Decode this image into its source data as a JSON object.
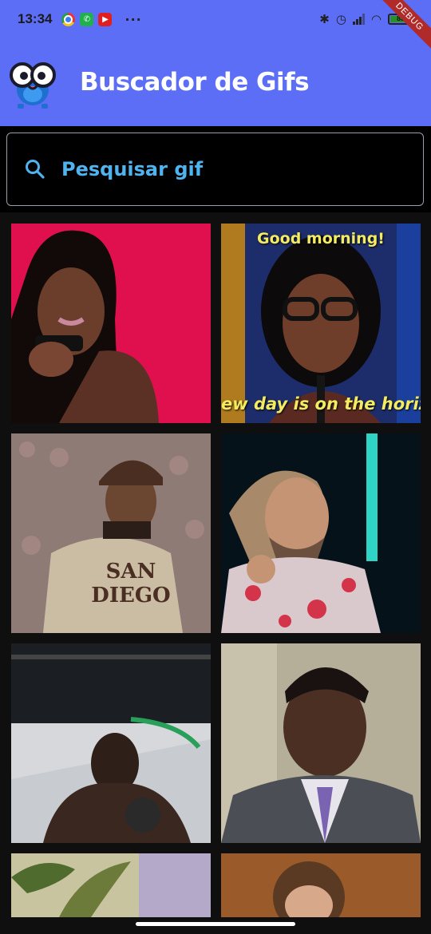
{
  "status_bar": {
    "time": "13:34",
    "battery_percent": "83",
    "icons": [
      "chrome-icon",
      "whatsapp-icon",
      "youtube-icon",
      "more-icon",
      "bluetooth-icon",
      "alarm-icon",
      "signal-icon",
      "wifi-icon",
      "battery-icon"
    ]
  },
  "debug_banner": "DEBUG",
  "app_bar": {
    "title": "Buscador de Gifs",
    "logo": "owl-mascot-icon"
  },
  "search": {
    "placeholder": "Pesquisar gif",
    "value": ""
  },
  "gifs": [
    {
      "caption_top": "",
      "caption_bottom": ""
    },
    {
      "caption_top": "Good morning!",
      "caption_bottom": "ew day is on the horiz"
    },
    {
      "caption_top": "",
      "caption_bottom": ""
    },
    {
      "caption_top": "",
      "caption_bottom": ""
    },
    {
      "caption_top": "",
      "caption_bottom": ""
    },
    {
      "caption_top": "",
      "caption_bottom": ""
    },
    {
      "caption_top": "",
      "caption_bottom": ""
    },
    {
      "caption_top": "",
      "caption_bottom": ""
    }
  ],
  "jersey_text": "SAN DIEGO",
  "colors": {
    "accent": "#5b6ef5",
    "search_text": "#4fb3f0",
    "background": "#000000"
  }
}
